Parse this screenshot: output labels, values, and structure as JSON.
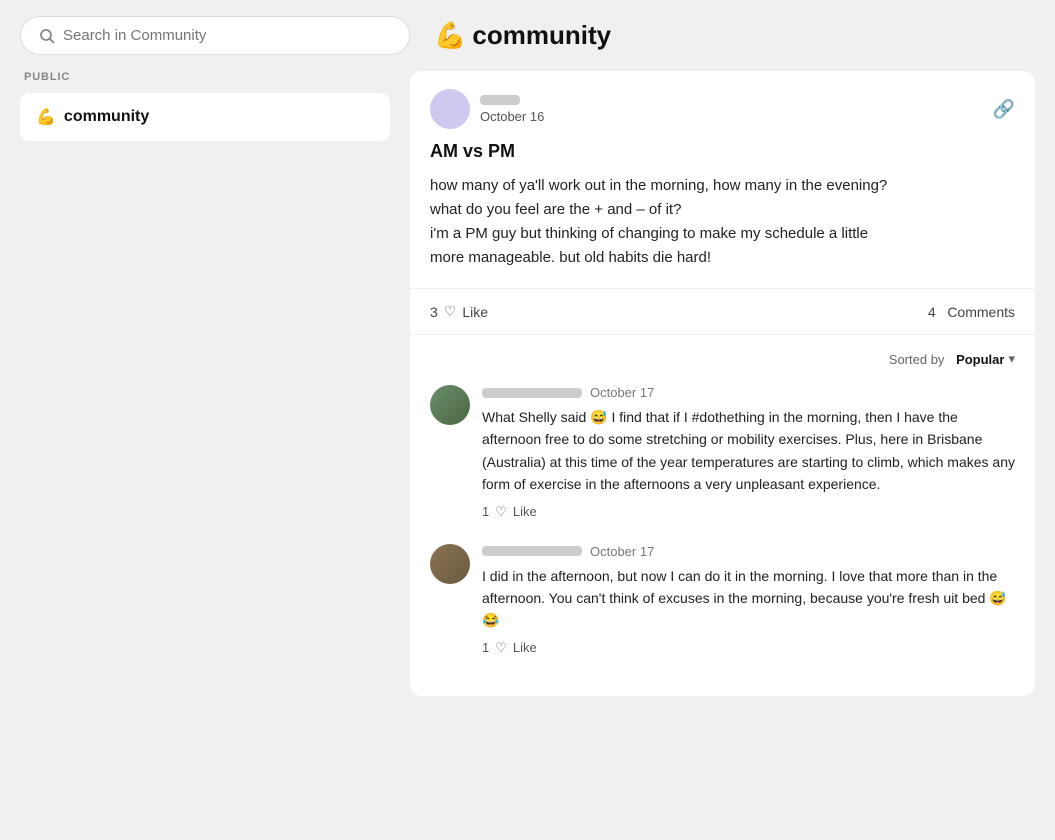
{
  "header": {
    "search_placeholder": "Search in Community",
    "title_emoji": "💪",
    "title_text": "community"
  },
  "sidebar": {
    "section_label": "PUBLIC",
    "community_item": {
      "emoji": "💪",
      "label": "community"
    }
  },
  "post": {
    "author_date": "October 16",
    "link_icon": "🔗",
    "title": "AM vs PM",
    "body_line1": "how many of ya'll work out in the morning, how many in the evening?",
    "body_line2": "what do you feel are the + and – of it?",
    "body_line3": "i'm a PM guy but thinking of changing to make my schedule a little",
    "body_line4": "more manageable. but old habits die hard!",
    "likes_count": "3",
    "like_label": "Like",
    "comments_count": "4",
    "comments_label": "Comments"
  },
  "sort": {
    "prefix": "Sorted by",
    "value": "Popular",
    "chevron": "▾"
  },
  "comments": [
    {
      "id": 1,
      "name_blurred": true,
      "date": "October 17",
      "text": "What Shelly said 😅 I find that if I #dothething in the morning, then I have the afternoon free to do some stretching or mobility exercises. Plus, here in Brisbane (Australia) at this time of the year temperatures are starting to climb, which makes any form of exercise in the afternoons a very unpleasant experience.",
      "likes": "1",
      "like_label": "Like"
    },
    {
      "id": 2,
      "name_blurred": true,
      "date": "October 17",
      "text": "I did in the afternoon, but now I can do it in the morning. I love that more than in the afternoon. You can't think of excuses in the morning, because you're fresh uit bed 😅😂",
      "likes": "1",
      "like_label": "Like"
    }
  ]
}
